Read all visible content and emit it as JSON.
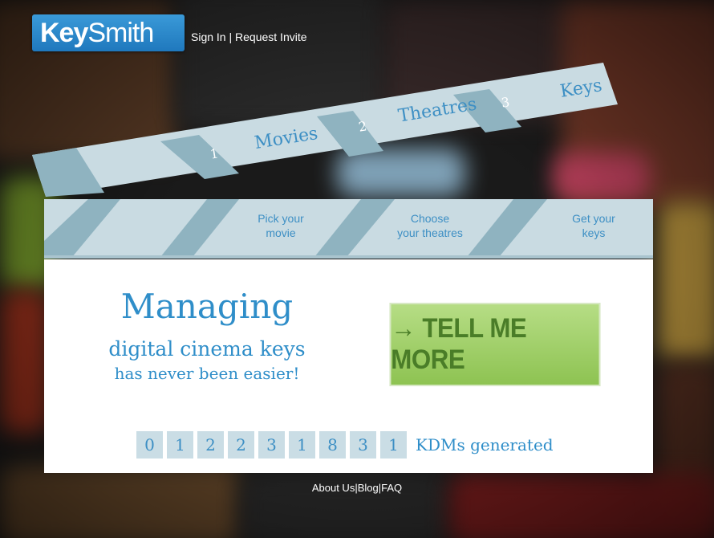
{
  "brand": {
    "name_part1": "Key",
    "name_part2": "Smith"
  },
  "header": {
    "sign_in": "Sign In",
    "separator": "|",
    "request_invite": "Request Invite"
  },
  "steps": [
    {
      "number": "1",
      "title": "Movies",
      "subtitle_line1": "Pick your",
      "subtitle_line2": "movie"
    },
    {
      "number": "2",
      "title": "Theatres",
      "subtitle_line1": "Choose",
      "subtitle_line2": "your theatres"
    },
    {
      "number": "3",
      "title": "Keys",
      "subtitle_line1": "Get your",
      "subtitle_line2": "keys"
    }
  ],
  "hero": {
    "headline": "Managing",
    "line2": "digital cinema keys",
    "line3": "has never been easier!"
  },
  "cta": {
    "label": "→ TELL ME MORE"
  },
  "counter": {
    "digits": [
      "0",
      "1",
      "2",
      "2",
      "3",
      "1",
      "8",
      "3",
      "1"
    ],
    "label": "KDMs generated"
  },
  "footer": {
    "about": "About Us",
    "blog": "Blog",
    "faq": "FAQ",
    "separator": "|"
  },
  "colors": {
    "accent": "#2f8ec9",
    "cta_green": "#8ec352",
    "board": "#c9dbe2",
    "stripe": "#8fb3c0"
  }
}
